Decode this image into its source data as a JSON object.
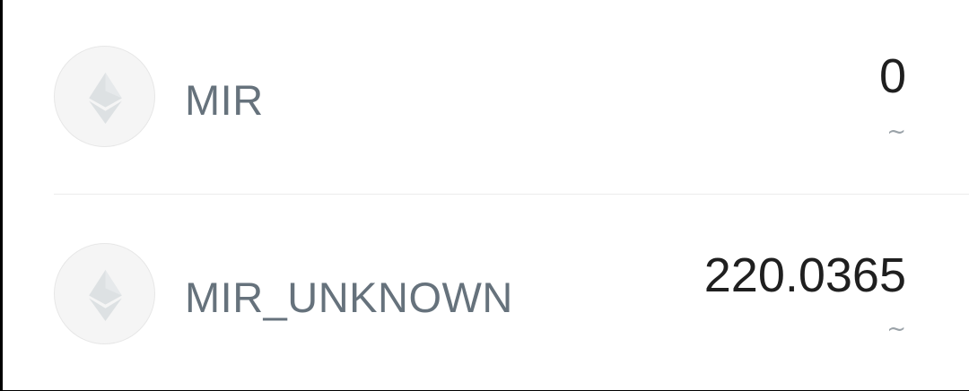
{
  "tokens": [
    {
      "icon": "ethereum-icon",
      "symbol": "MIR",
      "balance": "0",
      "fiat": "~"
    },
    {
      "icon": "ethereum-icon",
      "symbol": "MIR_UNKNOWN",
      "balance": "220.0365",
      "fiat": "~"
    }
  ],
  "colors": {
    "background": "#ffffff",
    "symbol_text": "#66727c",
    "balance_text": "#1f1f1f",
    "fiat_text": "#9aa2a8",
    "icon_fill": "#dde1e3",
    "avatar_bg": "#f5f5f5",
    "divider": "#ececec"
  }
}
